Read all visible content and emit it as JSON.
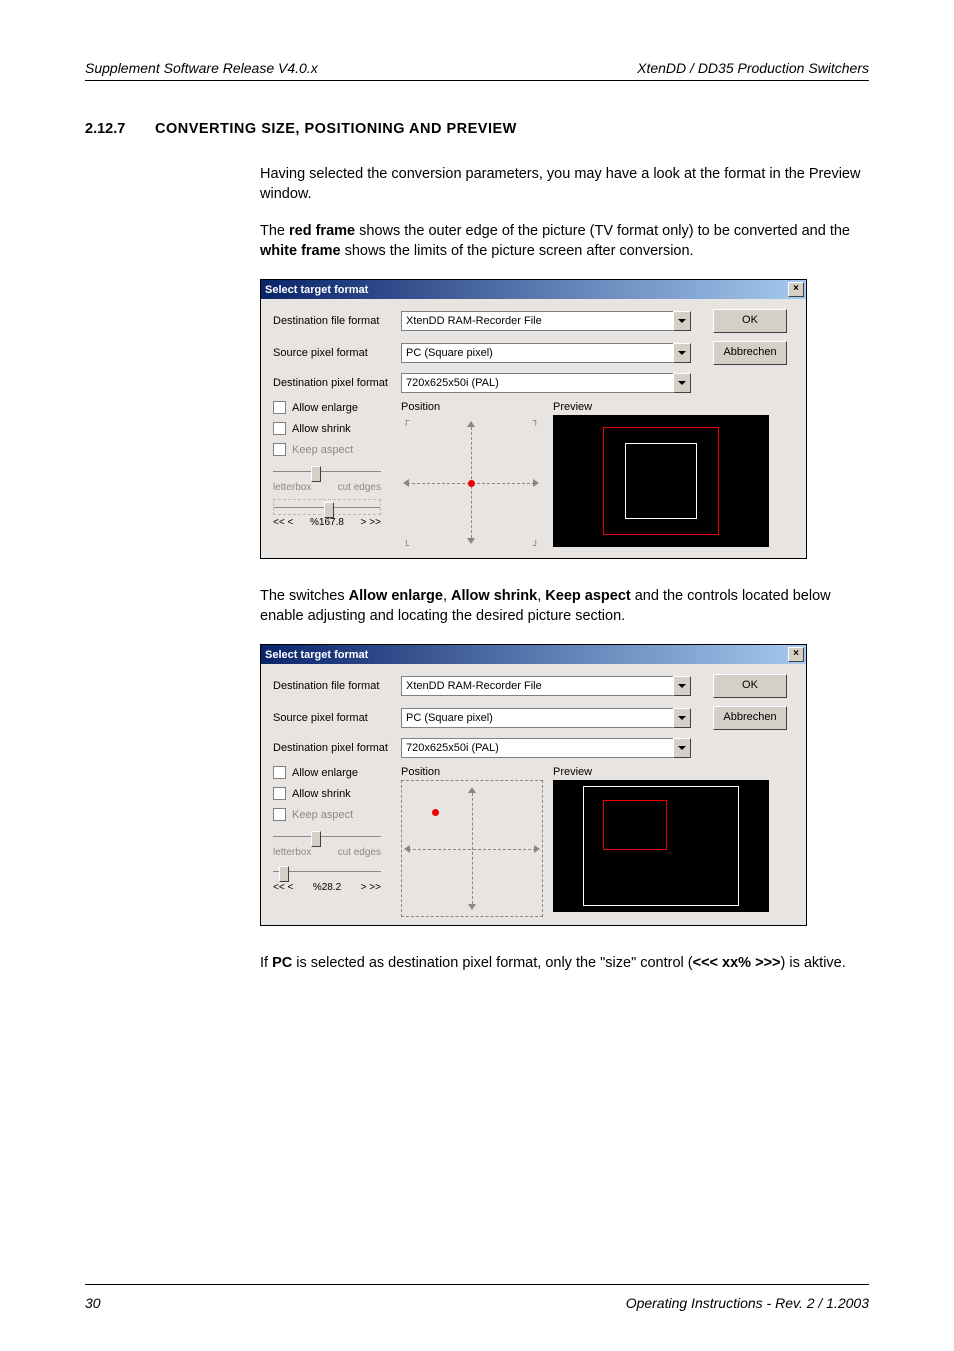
{
  "header": {
    "left": "Supplement Software Release V4.0.x",
    "right": "XtenDD / DD35 Production Switchers"
  },
  "section": {
    "num": "2.12.7",
    "title": "CONVERTING SIZE, POSITIONING AND PREVIEW"
  },
  "para1": "Having selected the conversion parameters, you may have a look at the format in the Preview window.",
  "para2_a": "The ",
  "para2_b": "red frame",
  "para2_c": " shows the outer edge of the picture (TV format only) to be converted and the ",
  "para2_d": "white frame",
  "para2_e": " shows the limits of the picture screen after conversion.",
  "dlg": {
    "title": "Select target format",
    "close": "×",
    "labels": {
      "dest_file": "Destination file format",
      "src_pixel": "Source pixel format",
      "dest_pixel": "Destination pixel format",
      "allow_enlarge": "Allow enlarge",
      "allow_shrink": "Allow shrink",
      "keep_aspect": "Keep aspect",
      "position": "Position",
      "preview": "Preview",
      "letterbox": "letterbox",
      "cut_edges": "cut edges"
    },
    "values": {
      "dest_file": "XtenDD RAM-Recorder File",
      "src_pixel": "PC (Square pixel)",
      "dest_pixel": "720x625x50i (PAL)"
    },
    "buttons": {
      "ok": "OK",
      "cancel": "Abbrechen"
    },
    "size1": {
      "left": "<< <",
      "val": "%167.8",
      "right": "> >>"
    },
    "size2": {
      "left": "<< <",
      "val": "%28.2",
      "right": "> >>"
    }
  },
  "para3_a": "The switches ",
  "para3_b": "Allow enlarge",
  "para3_c": ", ",
  "para3_d": "Allow shrink",
  "para3_e": ", ",
  "para3_f": "Keep aspect",
  "para3_g": " and the controls located below enable adjusting and locating the desired picture section.",
  "para4_a": "If ",
  "para4_b": "PC",
  "para4_c": " is selected as destination pixel format, only the \"size\" control (",
  "para4_d": "<<<  xx% >>>",
  "para4_e": ") is aktive.",
  "footer": {
    "left": "30",
    "right": "Operating Instructions - Rev. 2 / 1.2003"
  }
}
